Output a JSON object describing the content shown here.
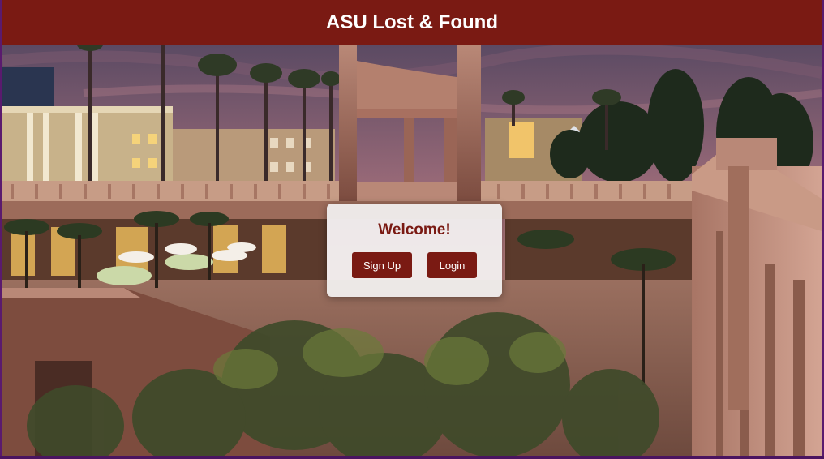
{
  "header": {
    "title": "ASU Lost & Found"
  },
  "welcome_card": {
    "heading": "Welcome!",
    "signup_label": "Sign Up",
    "login_label": "Login"
  },
  "colors": {
    "brand_maroon": "#7a1a13",
    "card_background": "#f5f5f5",
    "page_border": "#5a1a6e"
  },
  "hero_image": {
    "subject": "campus courtyard at dusk with palm trees"
  }
}
